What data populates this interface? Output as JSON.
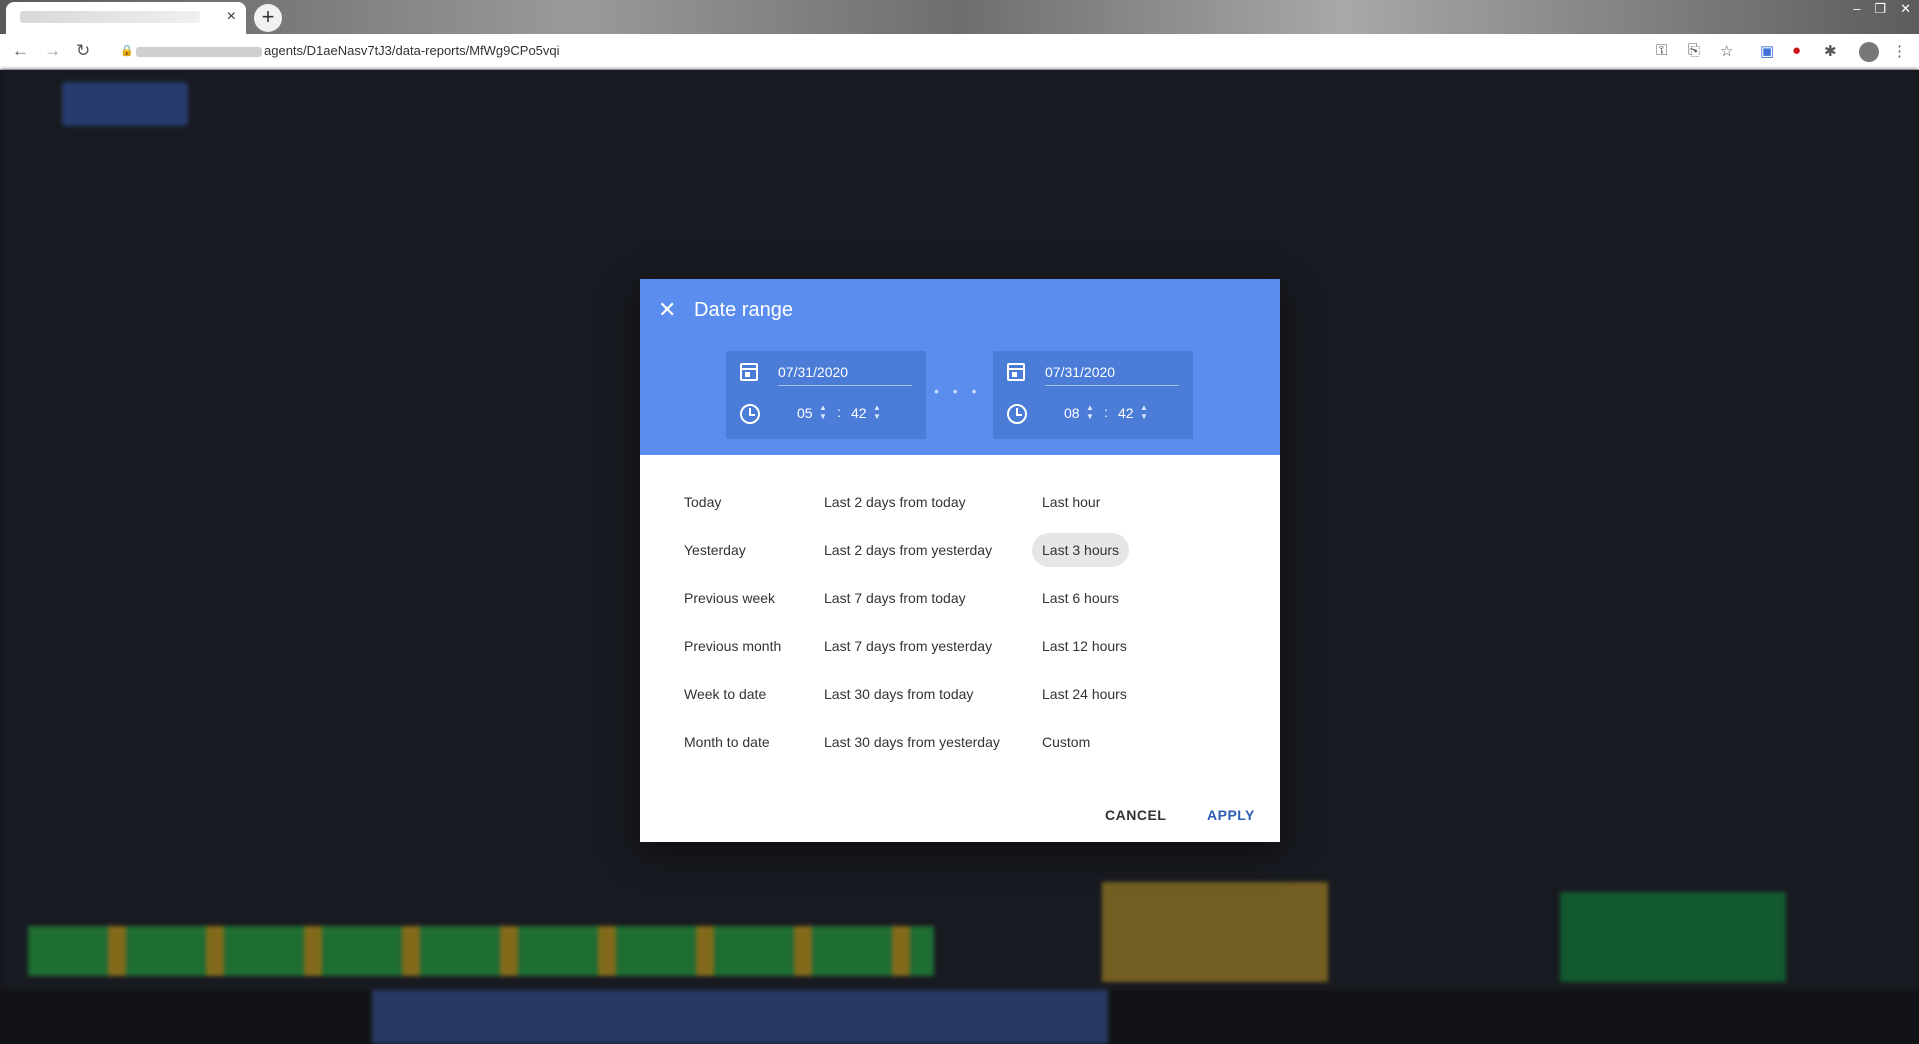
{
  "browser": {
    "tab_close": "×",
    "new_tab": "+",
    "url_visible": "agents/D1aeNasv7tJ3/data-reports/MfWg9CPo5vqi",
    "window_controls": [
      "–",
      "❐",
      "✕"
    ]
  },
  "dialog": {
    "title": "Date range",
    "close_icon": "close-icon",
    "start": {
      "date": "07/31/2020",
      "hour": "05",
      "minute": "42"
    },
    "end": {
      "date": "07/31/2020",
      "hour": "08",
      "minute": "42"
    },
    "separator": "• • •",
    "options_col1": [
      "Today",
      "Yesterday",
      "Previous week",
      "Previous month",
      "Week to date",
      "Month to date"
    ],
    "options_col2": [
      "Last 2 days from today",
      "Last 2 days from yesterday",
      "Last 7 days from today",
      "Last 7 days from yesterday",
      "Last 30 days from today",
      "Last 30 days from yesterday"
    ],
    "options_col3": [
      "Last hour",
      "Last 3 hours",
      "Last 6 hours",
      "Last 12 hours",
      "Last 24 hours",
      "Custom"
    ],
    "selected_option": "Last 3 hours",
    "cancel_label": "CANCEL",
    "apply_label": "APPLY"
  },
  "colors": {
    "header": "#5b8def",
    "range_box": "#4a7cd8",
    "apply": "#2d5db4"
  }
}
